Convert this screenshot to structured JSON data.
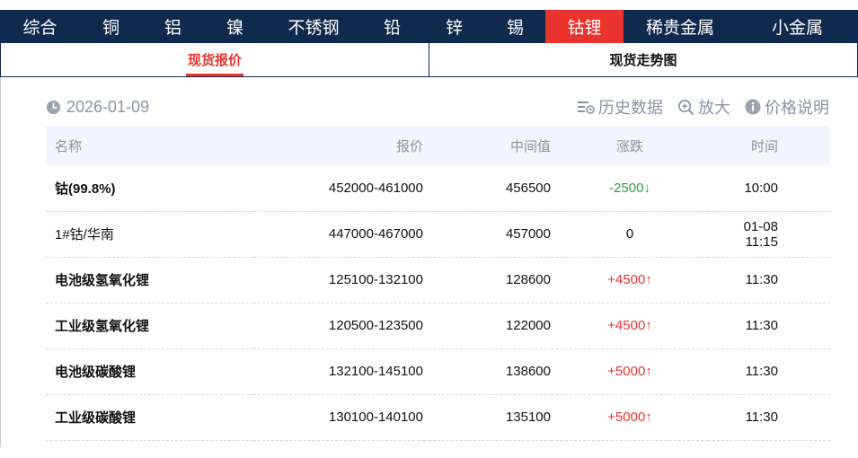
{
  "nav": {
    "items": [
      "综合",
      "铜",
      "铝",
      "镍",
      "不锈钢",
      "铅",
      "锌",
      "锡",
      "钴锂",
      "稀贵金属",
      "小金属"
    ],
    "active_index": 8
  },
  "subtabs": {
    "spot_price": "现货报价",
    "spot_trend": "现货走势图"
  },
  "toolbar": {
    "date": "2026-01-09",
    "history": "历史数据",
    "zoom": "放大",
    "price_note": "价格说明"
  },
  "table": {
    "headers": [
      "名称",
      "报价",
      "中间值",
      "涨跌",
      "时间"
    ],
    "rows": [
      {
        "name": "钴(99.8%)",
        "price": "452000-461000",
        "mid": "456500",
        "change": "-2500",
        "arrow": "↓",
        "dir": "down",
        "time": "10:00"
      },
      {
        "name": "1#钴/华南",
        "price": "447000-467000",
        "mid": "457000",
        "change": "0",
        "arrow": "",
        "dir": "flat",
        "time": "01-08 11:15"
      },
      {
        "name": "电池级氢氧化锂",
        "price": "125100-132100",
        "mid": "128600",
        "change": "+4500",
        "arrow": "↑",
        "dir": "up",
        "time": "11:30"
      },
      {
        "name": "工业级氢氧化锂",
        "price": "120500-123500",
        "mid": "122000",
        "change": "+4500",
        "arrow": "↑",
        "dir": "up",
        "time": "11:30"
      },
      {
        "name": "电池级碳酸锂",
        "price": "132100-145100",
        "mid": "138600",
        "change": "+5000",
        "arrow": "↑",
        "dir": "up",
        "time": "11:30"
      },
      {
        "name": "工业级碳酸锂",
        "price": "130100-140100",
        "mid": "135100",
        "change": "+5000",
        "arrow": "↑",
        "dir": "up",
        "time": "11:30"
      }
    ]
  },
  "colors": {
    "nav_bg": "#0f2a4d",
    "accent": "#e8332e",
    "up": "#e8332e",
    "down": "#2e9e3e"
  }
}
